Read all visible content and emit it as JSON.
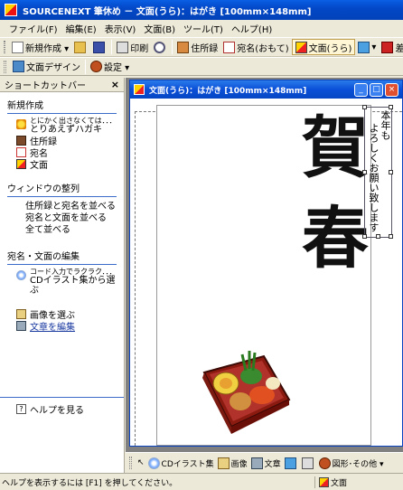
{
  "window": {
    "title": "SOURCENEXT 筆休め － 文面(うら)：はがき [100mm×148mm]"
  },
  "menu": [
    "ファイル(F)",
    "編集(E)",
    "表示(V)",
    "文面(B)",
    "ツール(T)",
    "ヘルプ(H)"
  ],
  "toolbar1": {
    "new_label": "新規作成 ▾",
    "print_label": "印刷",
    "address_label": "住所録",
    "name_label": "宛名(おもて)",
    "text_label": "文面(うら)",
    "send_label": "差出人"
  },
  "toolbar2": {
    "design_label": "文面デザイン",
    "settings_label": "設定 ▾"
  },
  "sidebar": {
    "title": "ショートカットバー",
    "close": "×",
    "sections": {
      "new": "新規作成",
      "window": "ウィンドウの整列",
      "edit": "宛名・文面の編集"
    },
    "quick_small": "とにかく出さなくては．．．",
    "quick_big": "とりあえずハガキ",
    "addressbook": "住所録",
    "addressee": "宛名",
    "message": "文面",
    "arrange1": "住所録と宛名を並べる",
    "arrange2": "宛名と文面を並べる",
    "arrange3": "全て並べる",
    "cd_small": "コード入力でラクラク．．．",
    "cd_big": "CDイラスト集から選ぶ",
    "choose_image": "画像を選ぶ",
    "edit_text": "文章を編集",
    "help": "ヘルプを見る"
  },
  "document": {
    "title": "文面(うら)：はがき [100mm×148mm]",
    "kanji1": "賀",
    "kanji2": "春",
    "vertical1": "本年も",
    "vertical2": "よろしくお願い致します"
  },
  "drawbar": {
    "cd_label": "CDイラスト集",
    "image_label": "画像",
    "text_label": "文章",
    "shape_label": "図形･その他 ▾"
  },
  "status": {
    "message": "ヘルプを表示するには [F1] を押してください。",
    "mode": "文面"
  }
}
